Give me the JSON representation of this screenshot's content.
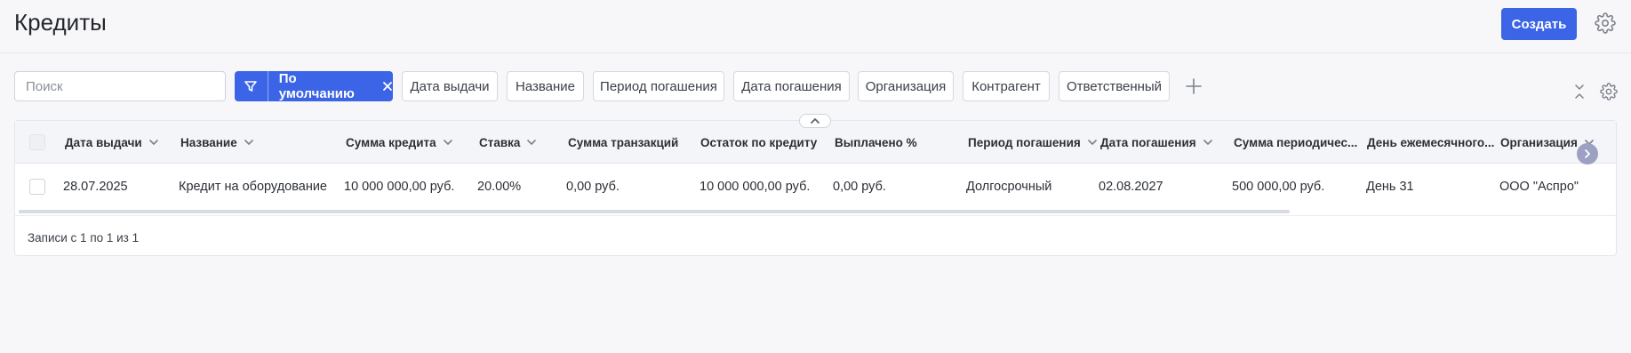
{
  "header": {
    "title": "Кредиты",
    "create_label": "Создать"
  },
  "filters": {
    "search_placeholder": "Поиск",
    "preset_label": "По умолчанию",
    "chips": [
      "Дата выдачи",
      "Название",
      "Период погашения",
      "Дата погашения",
      "Организация",
      "Контрагент",
      "Ответственный"
    ]
  },
  "table": {
    "columns": [
      "Дата выдачи",
      "Название",
      "Сумма кредита",
      "Ставка",
      "Сумма транзакций",
      "Остаток по кредиту",
      "Выплачено %",
      "Период погашения",
      "Дата погашения",
      "Сумма периодичес...",
      "День ежемесячного...",
      "Организация"
    ],
    "rows": [
      [
        "28.07.2025",
        "Кредит на оборудование",
        "10 000 000,00 руб.",
        "20.00%",
        "0,00 руб.",
        "10 000 000,00 руб.",
        "0,00 руб.",
        "Долгосрочный",
        "02.08.2027",
        "500 000,00 руб.",
        "День 31",
        "ООО \"Аспро\""
      ]
    ],
    "records_info": "Записи с 1 по 1 из 1"
  },
  "colors": {
    "accent": "#3c64e6",
    "background": "#f7f7f9"
  },
  "icons": [
    "gear-icon",
    "filter-icon",
    "close-icon",
    "plus-icon",
    "collapse-icon",
    "chevron-up-icon",
    "chevron-down-icon",
    "chevron-right-icon"
  ]
}
